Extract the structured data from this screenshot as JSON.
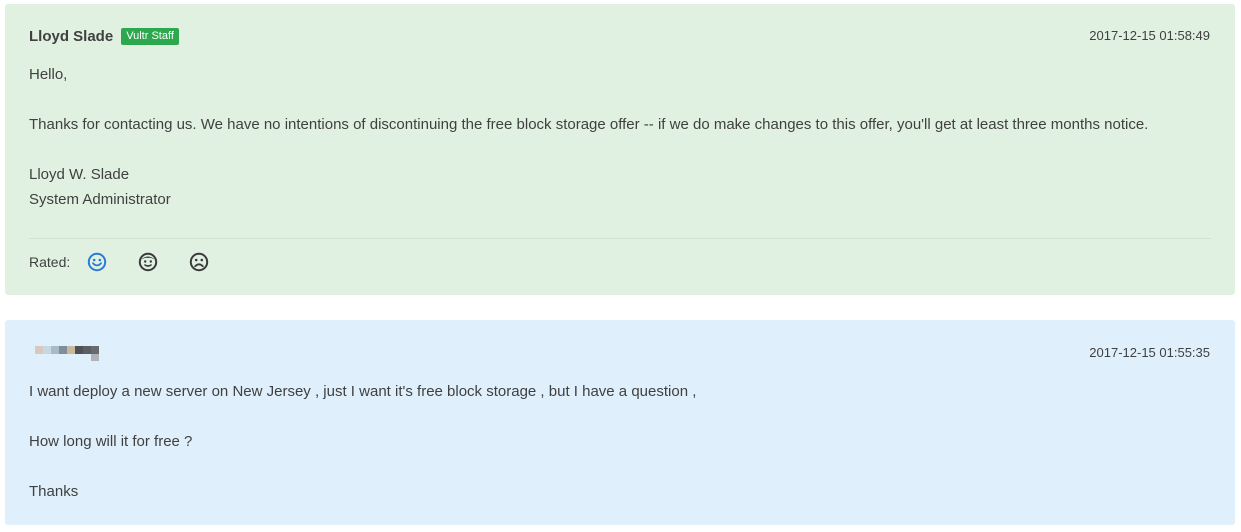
{
  "messages": [
    {
      "type": "staff",
      "author": "Lloyd Slade",
      "badge": "Vultr Staff",
      "timestamp": "2017-12-15 01:58:49",
      "lines": [
        "Hello,",
        "",
        "Thanks for contacting us. We have no intentions of discontinuing the free block storage offer -- if we do make changes to this offer, you'll get at least three months notice.",
        "",
        "Lloyd W. Slade",
        "System Administrator"
      ],
      "rating": {
        "label": "Rated:",
        "options": [
          {
            "icon": "smile-icon",
            "selected": true,
            "color": "#2b7bd6"
          },
          {
            "icon": "neutral-face-icon",
            "selected": false,
            "color": "#3a3a3a"
          },
          {
            "icon": "frown-icon",
            "selected": false,
            "color": "#3a3a3a"
          }
        ]
      },
      "background": "#e1f1e1",
      "badge_color": "#2ea84f"
    },
    {
      "type": "user",
      "author": "",
      "avatar_icon": "pixelated-avatar-icon",
      "timestamp": "2017-12-15 01:55:35",
      "lines": [
        "I want deploy a new server on New Jersey , just I want it's free block storage , but I have a question ,",
        "",
        "How long will it for free ?",
        "",
        "Thanks"
      ],
      "background": "#dff0fc"
    }
  ]
}
